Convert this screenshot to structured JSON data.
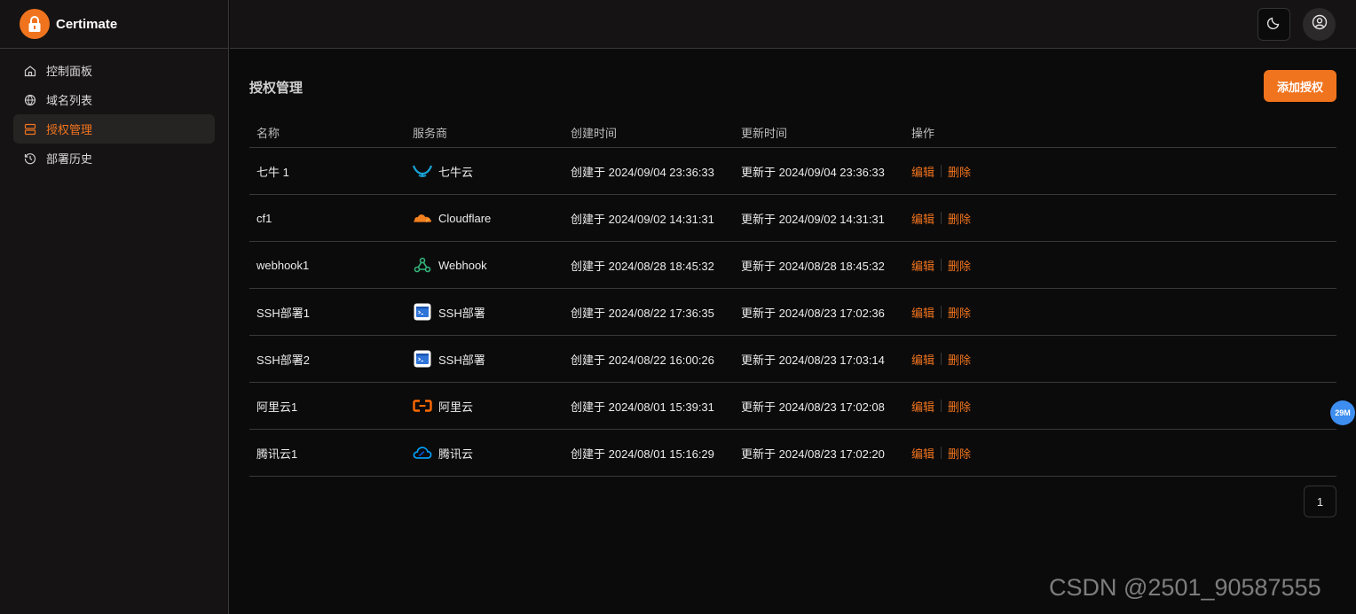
{
  "app": {
    "name": "Certimate"
  },
  "sidebar": {
    "items": [
      {
        "label": "控制面板",
        "icon": "home-icon",
        "active": false
      },
      {
        "label": "域名列表",
        "icon": "globe-icon",
        "active": false
      },
      {
        "label": "授权管理",
        "icon": "server-icon",
        "active": true
      },
      {
        "label": "部署历史",
        "icon": "history-icon",
        "active": false
      }
    ]
  },
  "header": {
    "theme_icon": "moon-icon",
    "user_icon": "user-circle-icon"
  },
  "page": {
    "title": "授权管理",
    "add_button": "添加授权"
  },
  "table": {
    "columns": [
      "名称",
      "服务商",
      "创建时间",
      "更新时间",
      "操作"
    ],
    "rows": [
      {
        "name": "七牛 1",
        "provider": "七牛云",
        "provider_icon": "qiniu-icon",
        "created": "创建于 2024/09/04 23:36:33",
        "updated": "更新于 2024/09/04 23:36:33"
      },
      {
        "name": "cf1",
        "provider": "Cloudflare",
        "provider_icon": "cloudflare-icon",
        "created": "创建于 2024/09/02 14:31:31",
        "updated": "更新于 2024/09/02 14:31:31"
      },
      {
        "name": "webhook1",
        "provider": "Webhook",
        "provider_icon": "webhook-icon",
        "created": "创建于 2024/08/28 18:45:32",
        "updated": "更新于 2024/08/28 18:45:32"
      },
      {
        "name": "SSH部署1",
        "provider": "SSH部署",
        "provider_icon": "ssh-icon",
        "created": "创建于 2024/08/22 17:36:35",
        "updated": "更新于 2024/08/23 17:02:36"
      },
      {
        "name": "SSH部署2",
        "provider": "SSH部署",
        "provider_icon": "ssh-icon",
        "created": "创建于 2024/08/22 16:00:26",
        "updated": "更新于 2024/08/23 17:03:14"
      },
      {
        "name": "阿里云1",
        "provider": "阿里云",
        "provider_icon": "aliyun-icon",
        "created": "创建于 2024/08/01 15:39:31",
        "updated": "更新于 2024/08/23 17:02:08"
      },
      {
        "name": "腾讯云1",
        "provider": "腾讯云",
        "provider_icon": "tencent-cloud-icon",
        "created": "创建于 2024/08/01 15:16:29",
        "updated": "更新于 2024/08/23 17:02:20"
      }
    ],
    "edit_label": "编辑",
    "delete_label": "删除"
  },
  "pagination": {
    "current_page": "1"
  },
  "float_badge": "29M",
  "watermark": "CSDN @2501_90587555",
  "colors": {
    "accent": "#f0741e",
    "background": "#0c0b0b",
    "sidebar": "#151313"
  }
}
